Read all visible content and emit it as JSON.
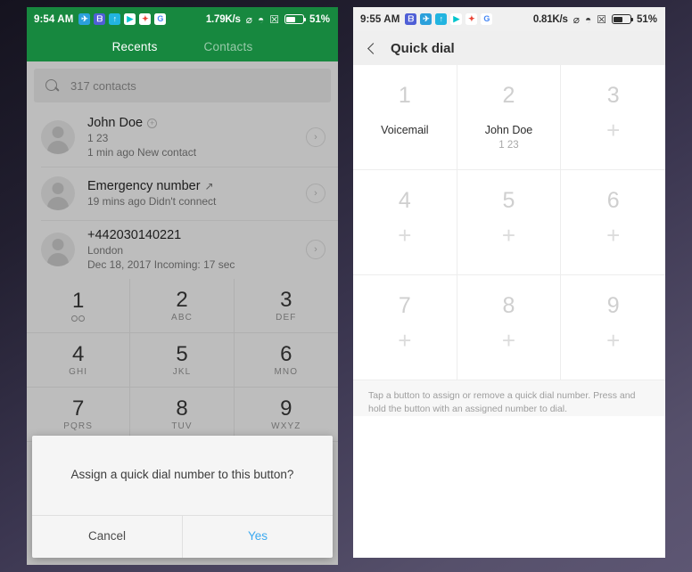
{
  "backdrop": {
    "color_top": "#15131f",
    "color_bottom": "#5d5673"
  },
  "left_phone": {
    "status_bar": {
      "time": "9:54 AM",
      "app_icons": [
        {
          "name": "telegram-icon",
          "glyph": "➤"
        },
        {
          "name": "app-icon-blue",
          "glyph": "⬛"
        },
        {
          "name": "upload-icon",
          "glyph": "↑"
        },
        {
          "name": "google-play-icon",
          "glyph": "▶"
        },
        {
          "name": "google-photos-icon",
          "glyph": "✸"
        },
        {
          "name": "google-icon",
          "glyph": "G"
        }
      ],
      "network_speed": "1.79K/s",
      "mute_icon": "⌀",
      "wifi_icon": "📶",
      "sim_icon": "☒",
      "battery_percent": "51%"
    },
    "tabs": [
      {
        "label": "Recents",
        "active": true
      },
      {
        "label": "Contacts",
        "active": false
      }
    ],
    "search": {
      "placeholder": "317 contacts",
      "icon": "search-icon"
    },
    "call_log": [
      {
        "name": "John Doe",
        "name_badge": "add-contact-icon",
        "line2": "1 23",
        "line3": "1 min ago New contact",
        "chevron": "chevron-right-icon"
      },
      {
        "name": "Emergency number",
        "name_badge": "outgoing-call-icon",
        "line2": "",
        "line3": "19 mins ago Didn't connect",
        "chevron": "chevron-right-icon"
      },
      {
        "name": "+442030140221",
        "name_badge": "",
        "line2": "London",
        "line3": "Dec 18, 2017 Incoming: 17 sec",
        "chevron": "chevron-right-icon"
      }
    ],
    "dialpad": [
      {
        "num": "1",
        "sub": "",
        "icon": "voicemail-icon"
      },
      {
        "num": "2",
        "sub": "ABC",
        "icon": ""
      },
      {
        "num": "3",
        "sub": "DEF",
        "icon": ""
      },
      {
        "num": "4",
        "sub": "GHI",
        "icon": ""
      },
      {
        "num": "5",
        "sub": "JKL",
        "icon": ""
      },
      {
        "num": "6",
        "sub": "MNO",
        "icon": ""
      },
      {
        "num": "7",
        "sub": "PQRS",
        "icon": ""
      },
      {
        "num": "8",
        "sub": "TUV",
        "icon": ""
      },
      {
        "num": "9",
        "sub": "WXYZ",
        "icon": ""
      }
    ],
    "dialog": {
      "message": "Assign a quick dial number to this button?",
      "cancel_label": "Cancel",
      "confirm_label": "Yes",
      "confirm_color": "#3ba9f0"
    }
  },
  "right_phone": {
    "status_bar": {
      "time": "9:55 AM",
      "app_icons": [
        {
          "name": "app-icon-blue",
          "glyph": "⬛"
        },
        {
          "name": "telegram-icon",
          "glyph": "➤"
        },
        {
          "name": "upload-icon",
          "glyph": "↑"
        },
        {
          "name": "google-play-icon",
          "glyph": "▶"
        },
        {
          "name": "google-photos-icon",
          "glyph": "✸"
        },
        {
          "name": "google-icon",
          "glyph": "G"
        }
      ],
      "network_speed": "0.81K/s",
      "mute_icon": "⌀",
      "wifi_icon": "📶",
      "sim_icon": "☒",
      "battery_percent": "51%"
    },
    "app_bar": {
      "back_icon": "back-arrow-icon",
      "title": "Quick dial"
    },
    "quick_dial": [
      {
        "num": "1",
        "label": "Voicemail",
        "sub": "",
        "empty": false
      },
      {
        "num": "2",
        "label": "John Doe",
        "sub": "1 23",
        "empty": false
      },
      {
        "num": "3",
        "label": "",
        "sub": "",
        "empty": true
      },
      {
        "num": "4",
        "label": "",
        "sub": "",
        "empty": true
      },
      {
        "num": "5",
        "label": "",
        "sub": "",
        "empty": true
      },
      {
        "num": "6",
        "label": "",
        "sub": "",
        "empty": true
      },
      {
        "num": "7",
        "label": "",
        "sub": "",
        "empty": true
      },
      {
        "num": "8",
        "label": "",
        "sub": "",
        "empty": true
      },
      {
        "num": "9",
        "label": "",
        "sub": "",
        "empty": true
      }
    ],
    "hint": "Tap a button to assign or remove a quick dial number. Press and hold the button with an assigned number to dial."
  }
}
